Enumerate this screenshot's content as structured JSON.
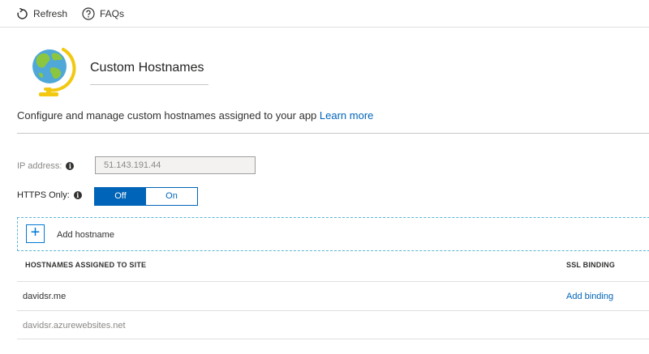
{
  "toolbar": {
    "refresh_label": "Refresh",
    "faqs_label": "FAQs"
  },
  "header": {
    "title": "Custom Hostnames",
    "icon": "globe-icon"
  },
  "description": {
    "text": "Configure and manage custom hostnames assigned to your app ",
    "link": "Learn more"
  },
  "ip_address": {
    "label": "IP address:",
    "value": "51.143.191.44"
  },
  "https_only": {
    "label": "HTTPS Only:",
    "options": [
      "Off",
      "On"
    ],
    "selected": "Off"
  },
  "add_hostname": {
    "label": "Add hostname"
  },
  "table": {
    "columns": [
      "HOSTNAMES ASSIGNED TO SITE",
      "SSL BINDING"
    ],
    "rows": [
      {
        "hostname": "davidsr.me",
        "ssl_binding": "Add binding"
      },
      {
        "hostname": "davidsr.azurewebsites.net",
        "ssl_binding": ""
      }
    ]
  },
  "colors": {
    "accent": "#0064b8",
    "toggle_selected_bg": "#0064b8",
    "dashed_border": "#5cb6d6",
    "muted_text": "#8a8886"
  }
}
